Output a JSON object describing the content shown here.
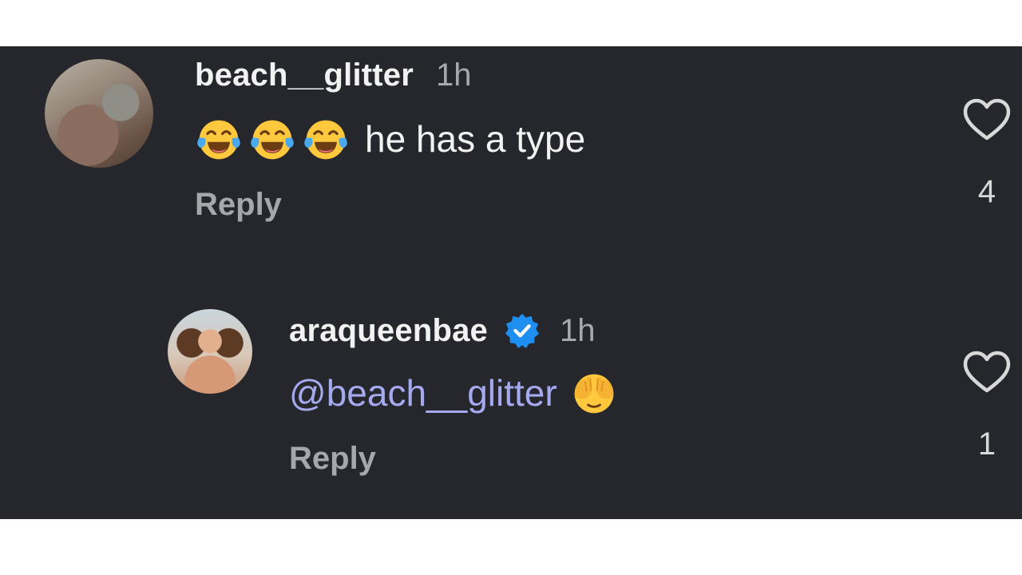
{
  "comments": [
    {
      "username": "beach__glitter",
      "time": "1h",
      "text": "he has a type",
      "emojis": [
        "face-with-tears-of-joy",
        "face-with-tears-of-joy",
        "face-with-tears-of-joy"
      ],
      "reply_label": "Reply",
      "like_count": "4",
      "like_icon": "heart-outline-icon"
    },
    {
      "username": "araqueenbae",
      "verified": true,
      "verified_color": "#1f8ef1",
      "time": "1h",
      "mention": "@beach__glitter",
      "emojis": [
        "face-with-hand-over-eyes"
      ],
      "reply_label": "Reply",
      "like_count": "1",
      "like_icon": "heart-outline-icon"
    }
  ],
  "colors": {
    "background": "#25272c",
    "mention": "#a5a9ee",
    "muted_text": "#a4a7ac",
    "primary_text": "#f2f2f2"
  }
}
